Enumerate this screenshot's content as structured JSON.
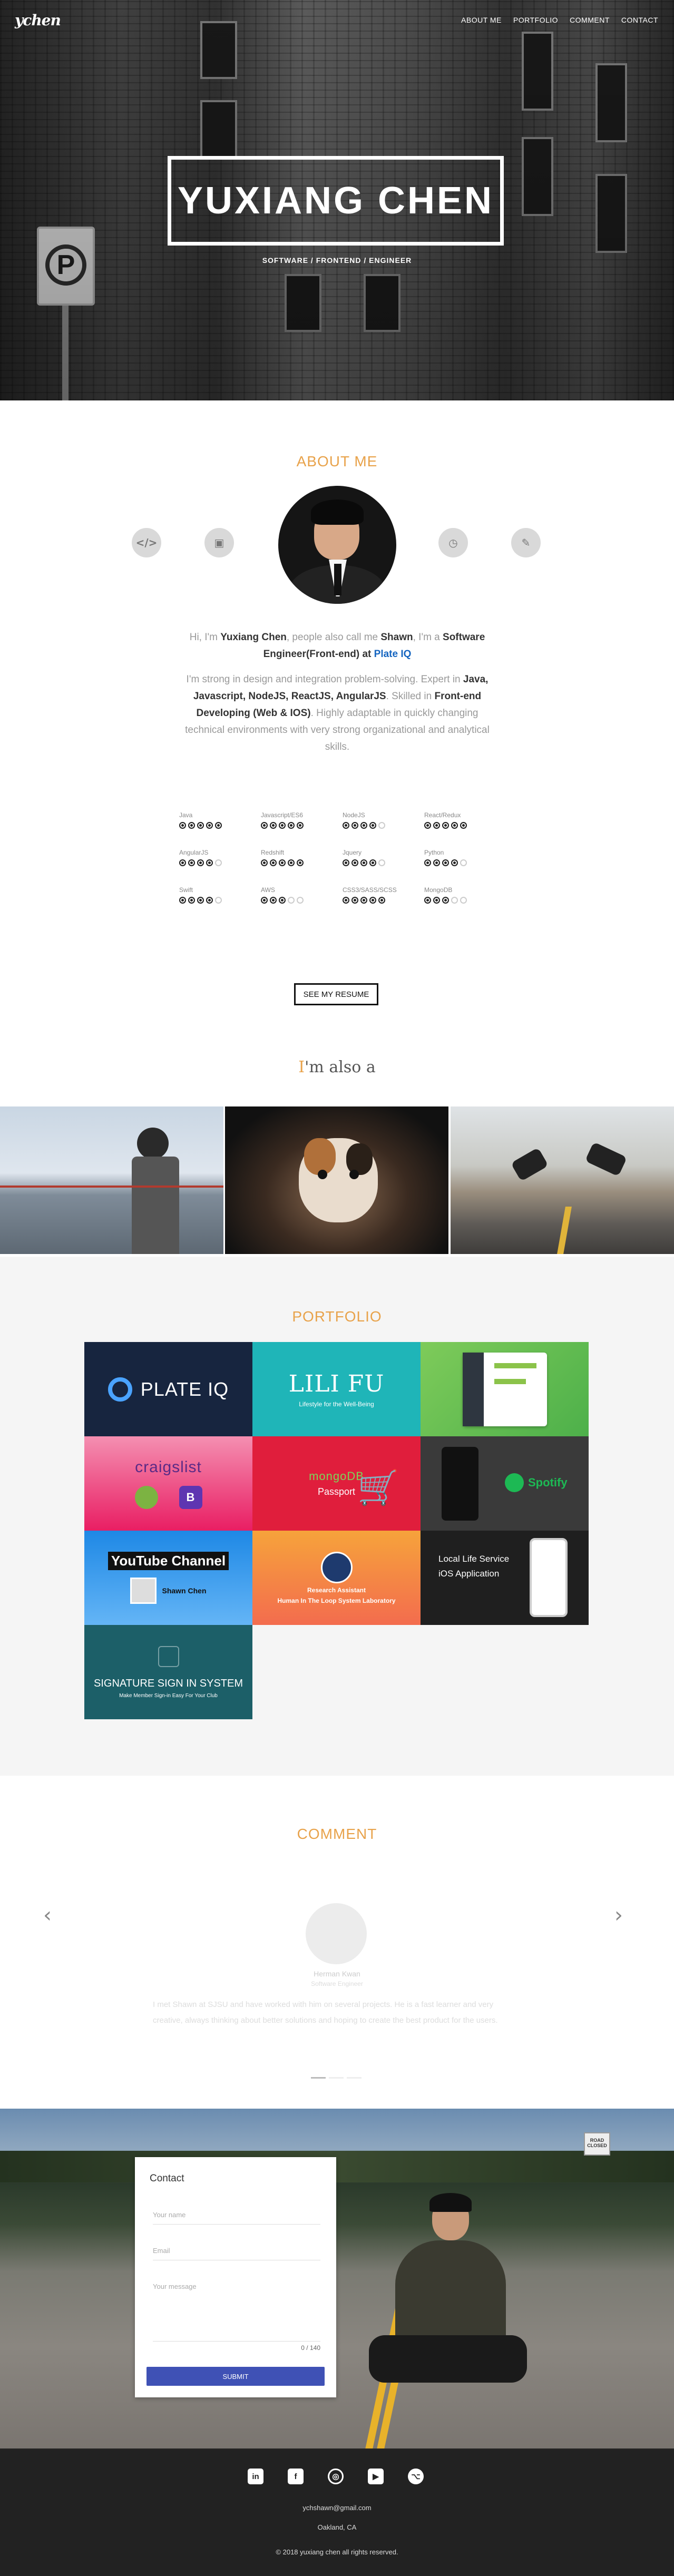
{
  "header": {
    "logo": "ychen",
    "nav": [
      "ABOUT ME",
      "PORTFOLIO",
      "COMMENT",
      "CONTACT"
    ],
    "hero_title": "YUXIANG CHEN",
    "hero_subtitle": "SOFTWARE / FRONTEND / ENGINEER"
  },
  "about": {
    "title": "ABOUT ME",
    "icons": [
      "code-icon",
      "image-icon",
      "clock-icon",
      "pencil-icon"
    ],
    "intro_1": {
      "hi": "Hi, I'm ",
      "name": "Yuxiang Chen",
      "mid": ", people also call me ",
      "nick": "Shawn",
      "mid2": ", I'm a ",
      "role": "Software Engineer(Front-end)",
      "at": " at ",
      "company": "Plate IQ"
    },
    "intro_2": {
      "a": "I'm strong in design and integration problem-solving. Expert in ",
      "tech": "Java, Javascript, NodeJS, ReactJS, AngularJS",
      "b": ". Skilled in ",
      "front": "Front-end Developing (Web & IOS)",
      "c": ". Highly adaptable in quickly changing technical environments with very strong organizational and analytical skills."
    },
    "skills": [
      {
        "name": "Java",
        "level": 5
      },
      {
        "name": "Javascript/ES6",
        "level": 5
      },
      {
        "name": "NodeJS",
        "level": 4
      },
      {
        "name": "React/Redux",
        "level": 5
      },
      {
        "name": "AngularJS",
        "level": 4
      },
      {
        "name": "Redshift",
        "level": 5
      },
      {
        "name": "Jquery",
        "level": 4
      },
      {
        "name": "Python",
        "level": 4
      },
      {
        "name": "Swift",
        "level": 4
      },
      {
        "name": "AWS",
        "level": 3
      },
      {
        "name": "CSS3/SASS/SCSS",
        "level": 5
      },
      {
        "name": "MongoDB",
        "level": 3
      }
    ],
    "resume_button": "SEE MY RESUME",
    "also_prefix": "I",
    "also_rest": "'m also a"
  },
  "portfolio": {
    "title": "PORTFOLIO",
    "tiles": [
      {
        "label": "PLATE IQ",
        "sub": "",
        "bg": "#17253f"
      },
      {
        "label": "LILI FU",
        "sub": "Lifestyle for the Well-Being",
        "bg": "#1fb5b8"
      },
      {
        "label": "",
        "sub": "",
        "bg": "#6ec25a"
      },
      {
        "label": "craigslist",
        "sub": "",
        "bg": "#f06292"
      },
      {
        "label": "mongoDB",
        "sub": "Passport",
        "bg": "#e01e3c"
      },
      {
        "label": "Spotify",
        "sub": "",
        "bg": "#3a3a3a"
      },
      {
        "label": "YouTube Channel",
        "sub": "Shawn Chen",
        "bg": "#2f7fd6"
      },
      {
        "label": "Research Assistant",
        "sub": "Human In The Loop System Laboratory",
        "bg": "#f6a33b"
      },
      {
        "label": "Local Life Service iOS Application",
        "sub": "",
        "bg": "#1f1f1f"
      },
      {
        "label": "SIGNATURE SIGN IN SYSTEM",
        "sub": "Make Member Sign-in Easy For Your Club",
        "bg": "#1c5f68"
      }
    ]
  },
  "comment": {
    "title": "COMMENT",
    "name": "Herman Kwan",
    "role": "Software Engineer",
    "text": "I met Shawn at SJSU and have worked with him on several projects. He is a fast learner and very creative, always thinking about better solutions and hoping to create the best product for the users."
  },
  "contact": {
    "title": "Contact",
    "name_placeholder": "Your name",
    "email_placeholder": "Email",
    "message_placeholder": "Your message",
    "counter": "0 / 140",
    "submit": "SUBMIT",
    "sign_text": "ROAD CLOSED"
  },
  "footer": {
    "social": [
      "in",
      "f",
      "◎",
      "▶",
      "⌥"
    ],
    "social_names": [
      "linkedin-icon",
      "facebook-icon",
      "instagram-icon",
      "youtube-icon",
      "github-icon"
    ],
    "email": "ychshawn@gmail.com",
    "location": "Oakland, CA",
    "copyright": "© 2018 yuxiang chen all rights reserved."
  },
  "colors": {
    "accent": "#e8a24a",
    "link": "#1565c0",
    "submit": "#3f51b5",
    "footer": "#222222"
  }
}
